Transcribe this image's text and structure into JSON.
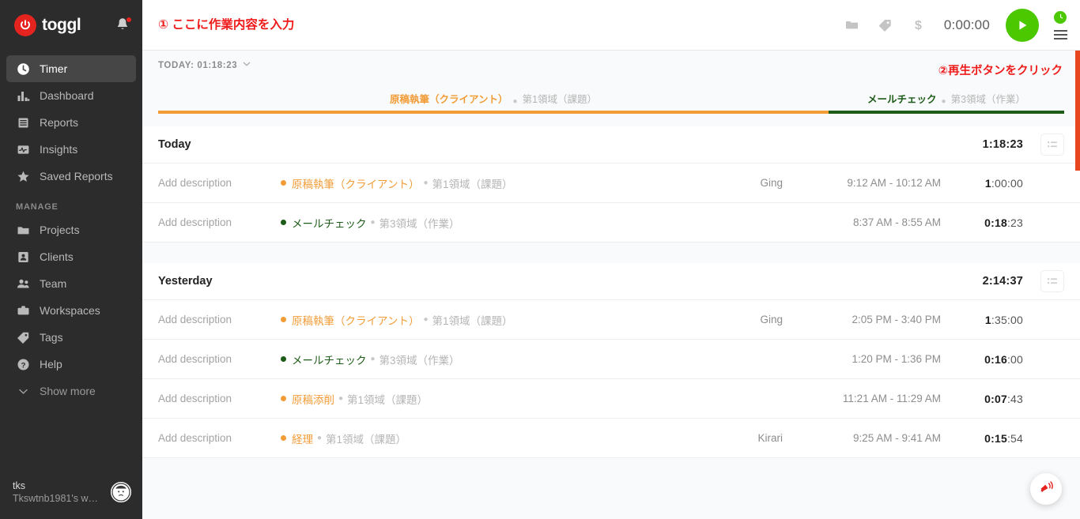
{
  "sidebar": {
    "brand": "toggl",
    "nav_primary": [
      {
        "label": "Timer",
        "icon": "clock-icon",
        "active": true
      },
      {
        "label": "Dashboard",
        "icon": "bar-chart-icon",
        "active": false
      },
      {
        "label": "Reports",
        "icon": "report-icon",
        "active": false
      },
      {
        "label": "Insights",
        "icon": "pulse-icon",
        "active": false
      },
      {
        "label": "Saved Reports",
        "icon": "star-icon",
        "active": false
      }
    ],
    "manage_label": "MANAGE",
    "nav_manage": [
      {
        "label": "Projects",
        "icon": "folder-icon"
      },
      {
        "label": "Clients",
        "icon": "person-card-icon"
      },
      {
        "label": "Team",
        "icon": "people-icon"
      },
      {
        "label": "Workspaces",
        "icon": "briefcase-icon"
      },
      {
        "label": "Tags",
        "icon": "tag-icon"
      },
      {
        "label": "Help",
        "icon": "question-circle-icon"
      }
    ],
    "show_more": "Show more",
    "user": {
      "name": "tks",
      "workspace": "Tkswtnb1981's wo…"
    }
  },
  "timerbar": {
    "description_placeholder": "① ここに作業内容を入力",
    "description_value": "",
    "elapsed": "0:00:00",
    "icons": [
      "folder-icon",
      "tag-icon",
      "dollar-icon"
    ],
    "play_label": "▶"
  },
  "annotations": {
    "step1": "① ここに作業内容を入力",
    "step2": "②再生ボタンをクリック",
    "color": "#ef1b1b"
  },
  "today_strip": {
    "label": "TODAY: 01:18:23"
  },
  "timeline": [
    {
      "project": "原稿執筆（クライアント）",
      "task": "第1領域（課題）",
      "color": "#f29c38",
      "width_pct": 74
    },
    {
      "project": "メールチェック",
      "task": "第3領域（作業）",
      "color": "#1d5c18",
      "width_pct": 26
    }
  ],
  "days": [
    {
      "name": "Today",
      "total": "1:18:23",
      "entries": [
        {
          "description": "Add description",
          "project": "原稿執筆（クライアント）",
          "project_color": "#f29c38",
          "task": "第1領域（課題）",
          "client": "Ging",
          "range": "9:12 AM - 10:12 AM",
          "duration_bold": "1",
          "duration_rest": ":00:00"
        },
        {
          "description": "Add description",
          "project": "メールチェック",
          "project_color": "#1d5c18",
          "task": "第3領域（作業）",
          "client": "",
          "range": "8:37 AM - 8:55 AM",
          "duration_bold": "0:18",
          "duration_rest": ":23"
        }
      ]
    },
    {
      "name": "Yesterday",
      "total": "2:14:37",
      "entries": [
        {
          "description": "Add description",
          "project": "原稿執筆（クライアント）",
          "project_color": "#f29c38",
          "task": "第1領域（課題）",
          "client": "Ging",
          "range": "2:05 PM - 3:40 PM",
          "duration_bold": "1",
          "duration_rest": ":35:00"
        },
        {
          "description": "Add description",
          "project": "メールチェック",
          "project_color": "#1d5c18",
          "task": "第3領域（作業）",
          "client": "",
          "range": "1:20 PM - 1:36 PM",
          "duration_bold": "0:16",
          "duration_rest": ":00"
        },
        {
          "description": "Add description",
          "project": "原稿添削",
          "project_color": "#f29c38",
          "task": "第1領域（課題）",
          "client": "",
          "range": "11:21 AM - 11:29 AM",
          "duration_bold": "0:07",
          "duration_rest": ":43"
        },
        {
          "description": "Add description",
          "project": "経理",
          "project_color": "#f29c38",
          "task": "第1領域（課題）",
          "client": "Kirari",
          "range": "9:25 AM - 9:41 AM",
          "duration_bold": "0:15",
          "duration_rest": ":54"
        }
      ]
    }
  ],
  "fab": {
    "icon": "megaphone-icon",
    "color": "#e5231f"
  },
  "colors": {
    "sidebar_bg": "#2c2c2c",
    "brand_red": "#e5231f",
    "play_green": "#4bc800",
    "orange_project": "#f29c38",
    "green_project": "#1d5c18",
    "annotation_red": "#ef1b1b"
  }
}
